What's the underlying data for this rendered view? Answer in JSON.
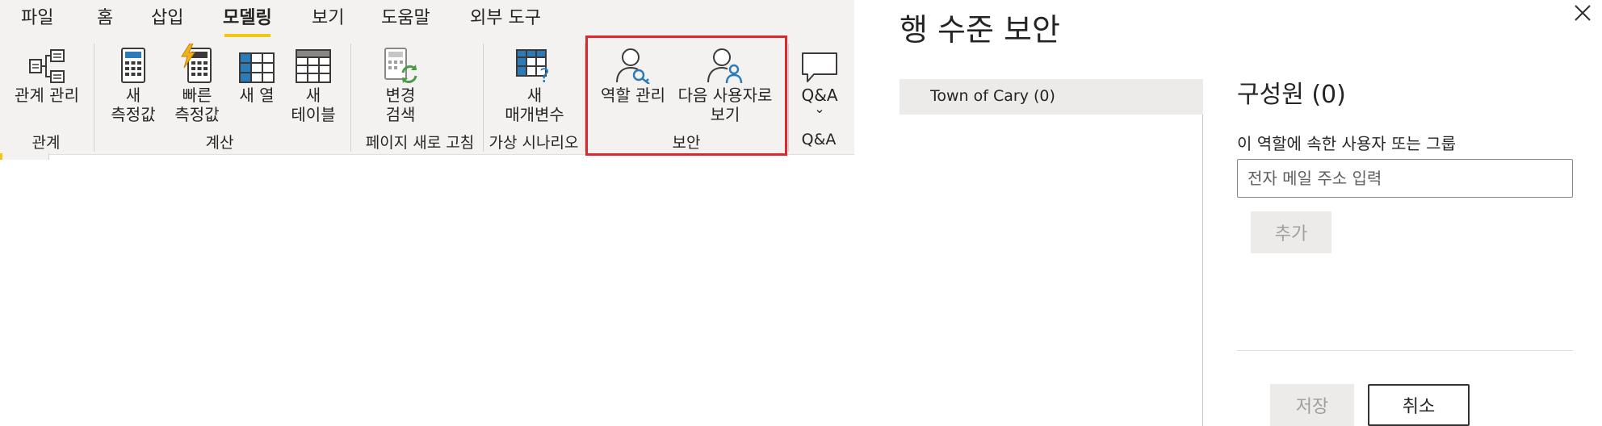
{
  "tabs": [
    {
      "label": "파일"
    },
    {
      "label": "홈"
    },
    {
      "label": "삽입"
    },
    {
      "label": "모델링",
      "active": true
    },
    {
      "label": "보기"
    },
    {
      "label": "도움말"
    },
    {
      "label": "외부 도구"
    }
  ],
  "ribbon": {
    "buttons": {
      "manage_relationships": "관계 관리",
      "new_measure": "새\n측정값",
      "quick_measure": "빠른\n측정값",
      "new_column": "새 열",
      "new_table": "새\n테이블",
      "change_detection": "변경\n검색",
      "new_parameter": "새\n매개변수",
      "manage_roles": "역할 관리",
      "view_as": "다음 사용자로\n보기",
      "qna": "Q&A",
      "qna_chevron": "⌄"
    },
    "groups": {
      "relationships": "관계",
      "calculations": "계산",
      "page_refresh": "페이지 새로 고침",
      "what_if": "가상 시나리오",
      "security": "보안",
      "qna": "Q&A"
    },
    "icons": {
      "manage_relationships": "relationships-icon",
      "new_measure": "calculator-icon",
      "quick_measure": "lightning-calculator-icon",
      "new_column": "table-column-icon",
      "new_table": "table-icon",
      "change_detection": "refresh-calculator-icon",
      "new_parameter": "table-question-icon",
      "manage_roles": "user-key-icon",
      "view_as": "user-person-icon",
      "qna": "speech-bubble-icon"
    }
  },
  "dialog": {
    "title": "행 수준 보안",
    "roles": [
      {
        "label": "Town of Cary (0)"
      }
    ],
    "members_title": "구성원 (0)",
    "members_subtitle": "이 역할에 속한 사용자 또는 그룹",
    "email_placeholder": "전자 메일 주소 입력",
    "add_label": "추가",
    "save_label": "저장",
    "cancel_label": "취소"
  },
  "colors": {
    "ribbon_bg": "#f3f2f1",
    "active_tab_underline": "#f2c811",
    "highlight_border": "#d9292f",
    "icon_blue": "#2b7bb9",
    "icon_green": "#4a9a4a"
  }
}
